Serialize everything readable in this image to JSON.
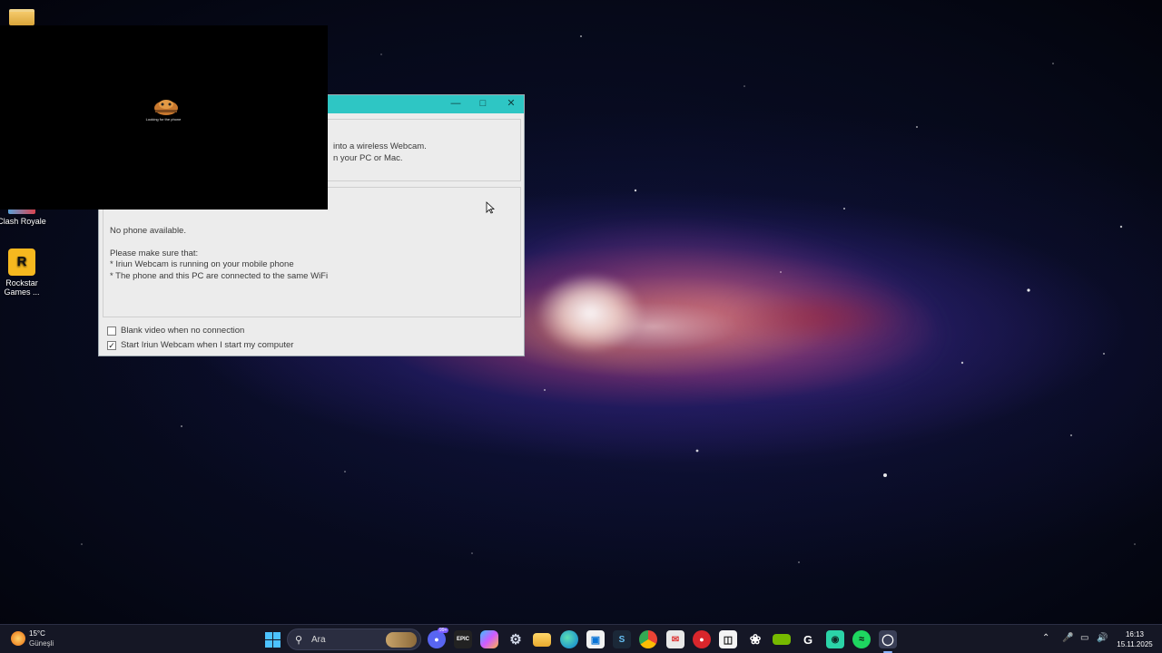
{
  "desktop": {
    "icons": [
      {
        "label": "Clash Royale",
        "icon": "clash-royale-icon"
      },
      {
        "label": "Rockstar Games ...",
        "icon": "rockstar-icon"
      }
    ]
  },
  "preview": {
    "status_text": "Looking for the phone"
  },
  "window": {
    "intro_line1": "into a wireless Webcam.",
    "intro_line2": "n your PC or Mac.",
    "no_phone": "No phone available.",
    "make_sure": "Please make sure that:",
    "bullet1": "* Iriun Webcam is running on your mobile phone",
    "bullet2": "* The phone and this PC are connected to the same WiFi",
    "checkbox_blank": {
      "label": "Blank video when no connection",
      "checked": false
    },
    "checkbox_start": {
      "label": "Start Iriun Webcam when I start my computer",
      "checked": true
    },
    "titlebar_color": "#2ec6c4"
  },
  "taskbar": {
    "weather_temp": "15°C",
    "weather_cond": "Güneşli",
    "search_placeholder": "Ara",
    "chat_badge": "99+",
    "clock_time": "16:13",
    "clock_date": "15.11.2025",
    "apps": [
      "windows-start-icon",
      "search-icon",
      "chat-icon",
      "epic-games-icon",
      "copilot-icon",
      "settings-icon",
      "file-explorer-icon",
      "edge-icon",
      "store-icon",
      "steam-icon",
      "chrome-icon",
      "mail-icon",
      "antivirus-icon",
      "capcut-icon",
      "chatgpt-icon",
      "nvidia-icon",
      "g-hub-icon",
      "gamepad-icon",
      "spotify-icon",
      "iriun-webcam-icon"
    ]
  }
}
